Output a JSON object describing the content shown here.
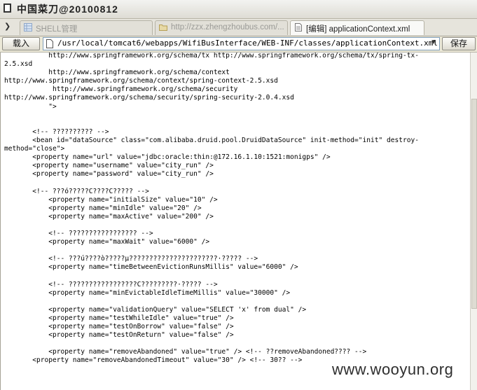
{
  "window": {
    "title": "中国菜刀@20100812"
  },
  "tabs": [
    {
      "label": "SHELL管理",
      "icon": "grid-icon",
      "active": false
    },
    {
      "label": "http://zzx.zhengzhoubus.com/...",
      "icon": "folder-icon",
      "active": false
    },
    {
      "label": "[编辑] applicationContext.xml",
      "icon": "document-icon",
      "active": true
    }
  ],
  "toolbar": {
    "load_label": "载入",
    "path_value": "/usr/local/tomcat6/webapps/WifiBusInterface/WEB-INF/classes/applicationContext.xml",
    "save_label": "保存"
  },
  "editor": {
    "content": "           http://www.springframework.org/schema/tx http://www.springframework.org/schema/tx/spring-tx-\n2.5.xsd\n           http://www.springframework.org/schema/context\nhttp://www.springframework.org/schema/context/spring-context-2.5.xsd\n            http://www.springframework.org/schema/security\nhttp://www.springframework.org/schema/security/spring-security-2.0.4.xsd\n           \">\n\n\n       <!-- ?????????? -->\n       <bean id=\"dataSource\" class=\"com.alibaba.druid.pool.DruidDataSource\" init-method=\"init\" destroy-\nmethod=\"close\">\n       <property name=\"url\" value=\"jdbc:oracle:thin:@172.16.1.10:1521:monigps\" />\n       <property name=\"username\" value=\"city_run\" />\n       <property name=\"password\" value=\"city_run\" />\n\n       <!-- ???ó?????C????C????? -->\n           <property name=\"initialSize\" value=\"10\" />\n           <property name=\"minIdle\" value=\"20\" />\n           <property name=\"maxActive\" value=\"200\" />\n\n           <!-- ????????????????? -->\n           <property name=\"maxWait\" value=\"6000\" />\n\n           <!-- ???ú????ò?????µ??????????????????????·????? -->\n           <property name=\"timeBetweenEvictionRunsMillis\" value=\"6000\" />\n\n           <!-- ?????????????????C?????????·????? -->\n           <property name=\"minEvictableIdleTimeMillis\" value=\"30000\" />\n\n           <property name=\"validationQuery\" value=\"SELECT 'x' from dual\" />\n           <property name=\"testWhileIdle\" value=\"true\" />\n           <property name=\"testOnBorrow\" value=\"false\" />\n           <property name=\"testOnReturn\" value=\"false\" />\n\n           <property name=\"removeAbandoned\" value=\"true\" /> <!-- ??removeAbandoned???? -->\n       <property name=\"removeAbandonedTimeout\" value=\"30\" /> <!-- 30?? -->"
  },
  "watermark": "www.wooyun.org",
  "colors": {
    "chrome": "#ece9d8",
    "path_border": "#7f9db9",
    "editor_bg": "#ffffff"
  }
}
